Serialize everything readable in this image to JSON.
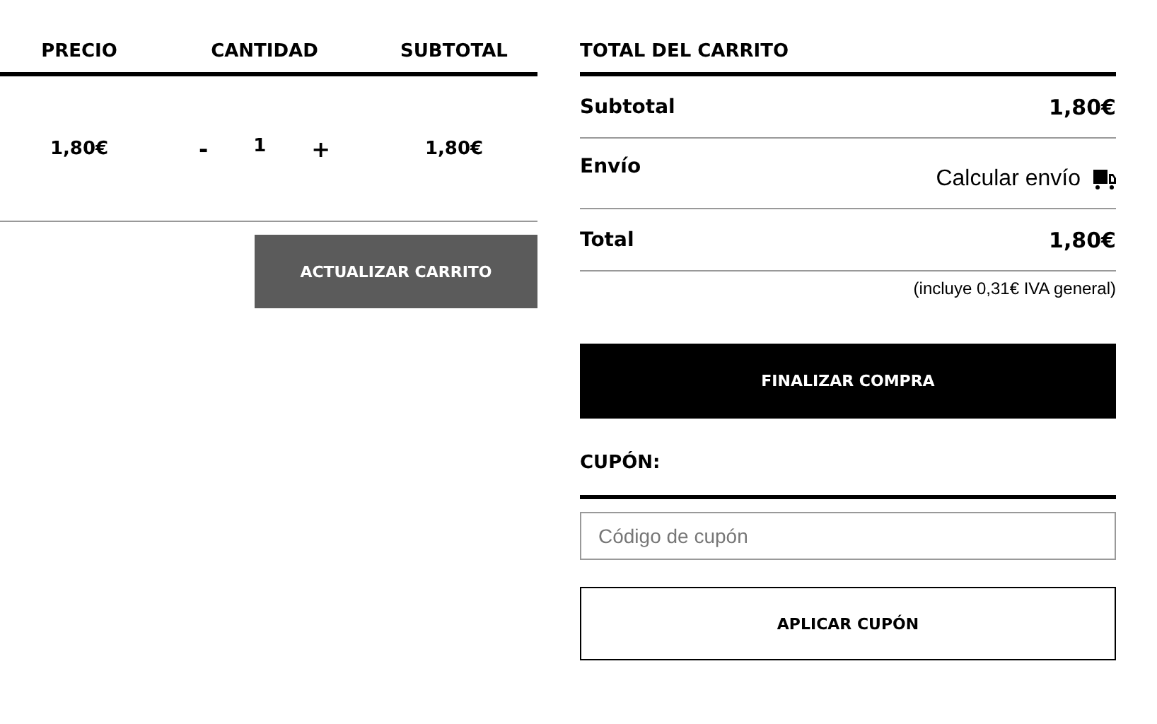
{
  "cart_table": {
    "columns": [
      "PRECIO",
      "CANTIDAD",
      "SUBTOTAL"
    ],
    "rows": [
      {
        "price": "1,80€",
        "decrement": "-",
        "quantity": "1",
        "increment": "+",
        "subtotal": "1,80€"
      }
    ],
    "update_button": "ACTUALIZAR CARRITO"
  },
  "cart_totals": {
    "title": "TOTAL DEL CARRITO",
    "rows": [
      {
        "kind": "amount",
        "label": "Subtotal",
        "value": "1,80€"
      },
      {
        "kind": "shipping",
        "label": "Envío",
        "value": "Calcular envío"
      },
      {
        "kind": "amount",
        "label": "Total",
        "value": "1,80€"
      }
    ],
    "tax_note": "(incluye 0,31€ IVA general)",
    "checkout_button": "FINALIZAR COMPRA",
    "coupon": {
      "title": "CUPÓN:",
      "placeholder": "Código de cupón",
      "button": "APLICAR CUPÓN"
    }
  }
}
